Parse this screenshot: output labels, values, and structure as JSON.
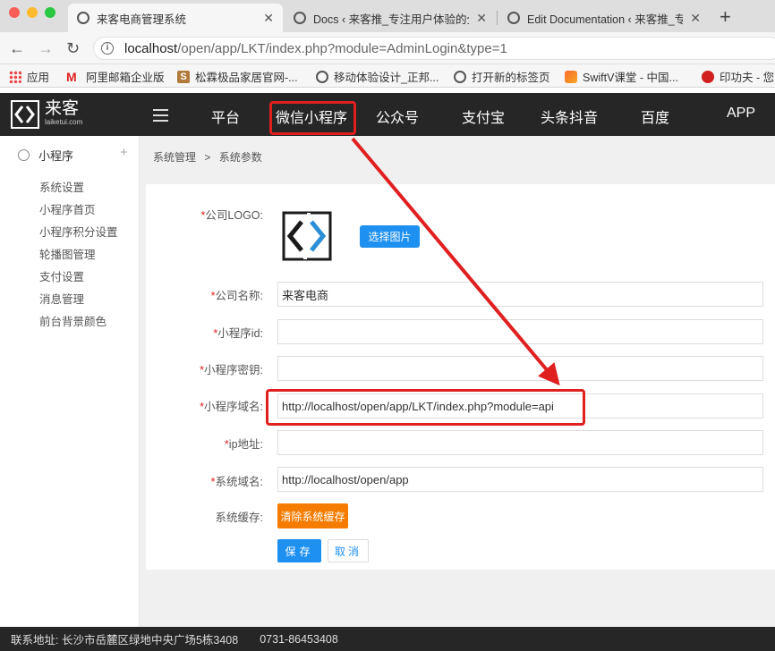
{
  "browser": {
    "tabs": [
      {
        "title": "来客电商管理系统",
        "active": true
      },
      {
        "title": "Docs ‹ 来客推_专注用户体验的全",
        "active": false
      },
      {
        "title": "Edit Documentation ‹ 来客推_专",
        "active": false
      }
    ],
    "url_host": "localhost",
    "url_path": "/open/app/LKT/index.php?module=AdminLogin&type=1",
    "bookmarks": [
      {
        "label": "应用",
        "icon": "apps-grid-icon"
      },
      {
        "label": "阿里邮箱企业版",
        "icon": "alimail-icon"
      },
      {
        "label": "松霖极品家居官网-...",
        "icon": "s-logo-icon"
      },
      {
        "label": "移动体验设计_正邦...",
        "icon": "globe-icon"
      },
      {
        "label": "打开新的标签页",
        "icon": "globe-icon"
      },
      {
        "label": "SwiftV课堂 - 中国...",
        "icon": "swift-icon"
      },
      {
        "label": "印功夫 - 您",
        "icon": "yingongfu-icon"
      }
    ]
  },
  "header": {
    "logo_name": "来客",
    "logo_sub": "laiketui.com",
    "nav": [
      "平台",
      "微信小程序",
      "公众号",
      "支付宝",
      "头条抖音",
      "百度",
      "APP"
    ]
  },
  "sidebar": {
    "title": "小程序",
    "items": [
      "系统设置",
      "小程序首页",
      "小程序积分设置",
      "轮播图管理",
      "支付设置",
      "消息管理",
      "前台背景颜色"
    ]
  },
  "breadcrumb": {
    "parent": "系统管理",
    "sep": ">",
    "current": "系统参数"
  },
  "form": {
    "logo_label": "公司LOGO:",
    "choose_image": "选择图片",
    "company_name_label": "公司名称:",
    "company_name_value": "来客电商",
    "appid_label": "小程序id:",
    "appid_value": "",
    "secret_label": "小程序密钥:",
    "secret_value": "",
    "domain_label": "小程序域名:",
    "domain_value": "http://localhost/open/app/LKT/index.php?module=api",
    "ip_label": "ip地址:",
    "ip_value": "",
    "sys_domain_label": "系统域名:",
    "sys_domain_value": "http://localhost/open/app",
    "cache_label": "系统缓存:",
    "clear_cache": "清除系统缓存",
    "save": "保存",
    "cancel": "取消",
    "required_mark": "*"
  },
  "footer": {
    "address": "联系地址: 长沙市岳麓区绿地中央广场5栋3408",
    "phone": "0731-86453408"
  },
  "colors": {
    "accent": "#1e90f0",
    "orange": "#f57c00",
    "highlight": "#e01f1f",
    "header_bg": "#262626"
  }
}
